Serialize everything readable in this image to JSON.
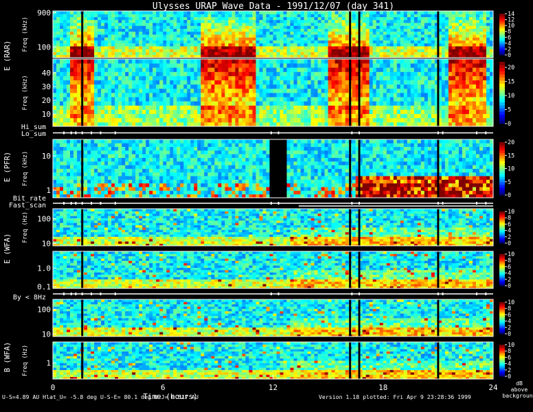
{
  "title": "Ulysses URAP Wave Data - 1991/12/07  (day 341)",
  "chart_data": {
    "type": "heatmap",
    "x": {
      "label": "Time (hours)",
      "range": [
        0,
        24
      ],
      "ticks": [
        0,
        6,
        12,
        18,
        24
      ]
    },
    "panels": [
      {
        "name": "E (RAR) upper",
        "row_label": "E (RAR)",
        "freq_label": "Freq (kHz)",
        "scale": "log",
        "ylim": [
          50,
          1000
        ],
        "yticks": [
          {
            "v": 100,
            "t": "100"
          },
          {
            "v": 900,
            "t": "900"
          }
        ],
        "colorbar": {
          "range": [
            0,
            14
          ],
          "ticks": [
            0,
            2,
            4,
            6,
            8,
            10,
            12,
            14
          ]
        }
      },
      {
        "name": "E (RAR) lower",
        "row_label": "",
        "freq_label": "Freq (kHz)",
        "scale": "linear",
        "ylim": [
          1,
          50
        ],
        "yticks": [
          {
            "v": 10,
            "t": "10"
          },
          {
            "v": 20,
            "t": "20"
          },
          {
            "v": 30,
            "t": "30"
          },
          {
            "v": 40,
            "t": "40"
          }
        ],
        "colorbar": {
          "range": [
            0,
            22
          ],
          "ticks": [
            0,
            5,
            10,
            15,
            20
          ]
        }
      },
      {
        "name": "E (PFR)",
        "row_label": "E (PFR)",
        "freq_label": "Freq (kHz)",
        "scale": "log",
        "ylim": [
          0.6,
          30
        ],
        "yticks": [
          {
            "v": 1,
            "t": "1"
          },
          {
            "v": 10,
            "t": "10"
          }
        ],
        "colorbar": {
          "range": [
            0,
            20
          ],
          "ticks": [
            0,
            5,
            10,
            15,
            20
          ]
        }
      },
      {
        "name": "E (WFA) upper",
        "row_label": "E (WFA)",
        "freq_label": "Freq (Hz)",
        "scale": "log",
        "ylim": [
          8,
          250
        ],
        "yticks": [
          {
            "v": 10,
            "t": "10"
          },
          {
            "v": 100,
            "t": "100"
          }
        ],
        "colorbar": {
          "range": [
            0,
            10
          ],
          "ticks": [
            0,
            2,
            4,
            6,
            8,
            10
          ]
        }
      },
      {
        "name": "E (WFA) lower",
        "row_label": "",
        "freq_label": "",
        "scale": "log",
        "ylim": [
          0.08,
          8
        ],
        "yticks": [
          {
            "v": 0.1,
            "t": "0.1"
          },
          {
            "v": 1,
            "t": "1.0"
          }
        ],
        "colorbar": {
          "range": [
            0,
            10
          ],
          "ticks": [
            0,
            2,
            4,
            6,
            8,
            10
          ]
        }
      },
      {
        "name": "B (WFA) upper",
        "row_label": "",
        "freq_label": "",
        "scale": "log",
        "ylim": [
          8,
          250
        ],
        "yticks": [
          {
            "v": 10,
            "t": "10"
          },
          {
            "v": 100,
            "t": "100"
          }
        ],
        "colorbar": {
          "range": [
            0,
            10
          ],
          "ticks": [
            0,
            2,
            4,
            6,
            8,
            10
          ]
        }
      },
      {
        "name": "B (WFA) lower",
        "row_label": "B (WFA)",
        "freq_label": "Freq (Hz)",
        "scale": "log",
        "ylim": [
          0.2,
          8
        ],
        "yticks": [
          {
            "v": 1,
            "t": "1"
          }
        ],
        "colorbar": {
          "range": [
            0,
            10
          ],
          "ticks": [
            0,
            2,
            4,
            6,
            8,
            10
          ]
        }
      }
    ],
    "status_strips": [
      {
        "labels": [
          "Hi_sum",
          "Lo_sum"
        ]
      },
      {
        "labels": [
          "Bit_rate",
          "Fast_scan"
        ]
      },
      {
        "labels": [
          "By < 8Hz"
        ]
      }
    ],
    "burst_times_hours": [
      0.6,
      1.0,
      1.25,
      1.6,
      2.1,
      2.6,
      3.4,
      11.9,
      12.3,
      16.3,
      16.7,
      21.0,
      21.25,
      23.1,
      23.6
    ],
    "data_gaps_hours": [
      [
        11.8,
        12.8
      ]
    ],
    "bright_emissions_hours": [
      [
        1.0,
        2.2
      ],
      [
        8.0,
        11.0
      ],
      [
        15.0,
        17.2
      ],
      [
        21.5,
        23.7
      ]
    ],
    "black_stripes_hours": [
      1.6,
      16.2,
      16.7,
      21.0
    ],
    "colorbar_unit": [
      "dB",
      "above",
      "background"
    ]
  },
  "footer": {
    "ephemeris": "U-S=4.89 AU   Hlat_U= -5.8 deg   U-S-E= 80.1 deg   U-J= 0.517 AU",
    "version": "Version 1.18 plotted: Fri Apr  9 23:28:36 1999"
  }
}
